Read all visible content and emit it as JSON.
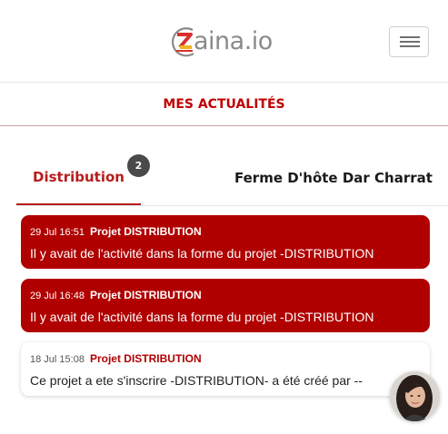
{
  "header": {
    "logo_text": "aina.io",
    "logo_mark_letter": "Z",
    "brand_colors": {
      "red": "#d6322b",
      "yellow": "#f2b51d",
      "gray": "#8a8a8a"
    }
  },
  "section": {
    "title": "MES ACTUALITÉS"
  },
  "tabs": [
    {
      "label": "Distribution",
      "badge": "2",
      "active": true
    },
    {
      "label": "Ferme D'hôte Dar Charrat",
      "active": false
    }
  ],
  "notifications": [
    {
      "time": "29 Jul 16:51",
      "project": "Projet DISTRIBUTION",
      "message": "Il y avait de l'activité dans la forme du projet -DISTRIBUTION",
      "unread": true
    },
    {
      "time": "29 Jul 16:48",
      "project": "Projet DISTRIBUTION",
      "message": "Il y avait de l'activité dans la forme du projet -DISTRIBUTION",
      "unread": true
    },
    {
      "time": "18 Jul 15:08",
      "project": "Projet DISTRIBUTION",
      "message": "Ce projet a ete s'inscrire -DISTRIBUTION- a été créé par --",
      "unread": false
    }
  ],
  "colors": {
    "accent": "#b00000",
    "badge": "#4a4a4a"
  },
  "icons": {
    "menu": "hamburger-icon",
    "chat": "chat-avatar"
  }
}
